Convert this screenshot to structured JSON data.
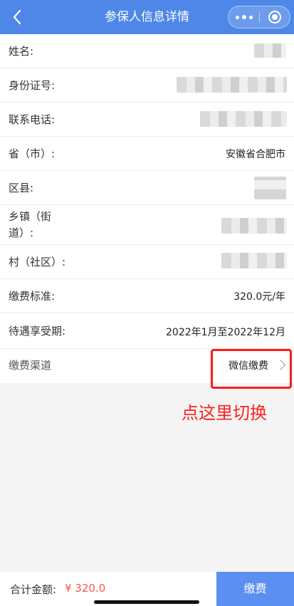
{
  "navbar": {
    "title": "参保人信息详情",
    "back_icon": "chevron-left-icon",
    "more_icon": "more-dots-icon",
    "close_icon": "target-circle-icon"
  },
  "fields": [
    {
      "label": "姓名:",
      "value": ""
    },
    {
      "label": "身份证号:",
      "value": ""
    },
    {
      "label": "联系电话:",
      "value": ""
    },
    {
      "label": "省（市）:",
      "value": "安徽省合肥市"
    },
    {
      "label": "区县:",
      "value": ""
    },
    {
      "label": "乡镇（街道）:",
      "label_line1": "乡镇（街",
      "label_line2": "道）:",
      "value": ""
    },
    {
      "label": "村（社区）:",
      "value": ""
    },
    {
      "label": "缴费标准:",
      "value": "320.0元/年"
    },
    {
      "label": "待遇享受期:",
      "value": "2022年1月至2022年12月"
    },
    {
      "label": "缴费渠道",
      "value": "微信缴费"
    }
  ],
  "annotation": "点这里切换",
  "bottom": {
    "total_label": "合计金额:",
    "total_value": "¥ 320.0",
    "pay_button": "缴费"
  },
  "colors": {
    "navbar": "#4e87e8",
    "pay_button": "#5b8ff0",
    "price": "#f05a4a",
    "annotation": "#ff2020"
  }
}
